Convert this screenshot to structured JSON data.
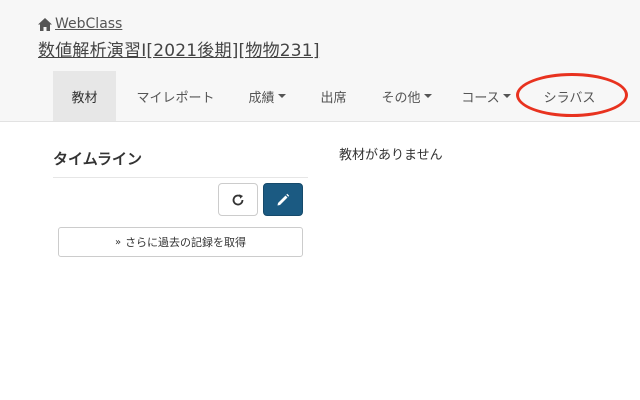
{
  "header": {
    "home_link": "WebClass",
    "course_title": "数値解析演習Ⅰ[2021後期][物物231]"
  },
  "nav": {
    "items": [
      {
        "label": "教材",
        "active": true,
        "dropdown": false
      },
      {
        "label": "マイレポート",
        "active": false,
        "dropdown": false
      },
      {
        "label": "成績",
        "active": false,
        "dropdown": true
      },
      {
        "label": "出席",
        "active": false,
        "dropdown": false
      },
      {
        "label": "その他",
        "active": false,
        "dropdown": true
      },
      {
        "label": "コース",
        "active": false,
        "dropdown": true
      },
      {
        "label": "シラバス",
        "active": false,
        "dropdown": false
      }
    ]
  },
  "timeline": {
    "title": "タイムライン",
    "refresh_icon": "refresh-icon",
    "edit_icon": "pencil-icon",
    "more_button_label": "さらに過去の記録を取得",
    "more_button_icon": "»"
  },
  "main": {
    "empty_message": "教材がありません"
  },
  "colors": {
    "header_bg": "#f7f7f7",
    "active_tab_bg": "#e7e7e7",
    "primary_button": "#1b5a82",
    "annotation_red": "#e8321f"
  }
}
